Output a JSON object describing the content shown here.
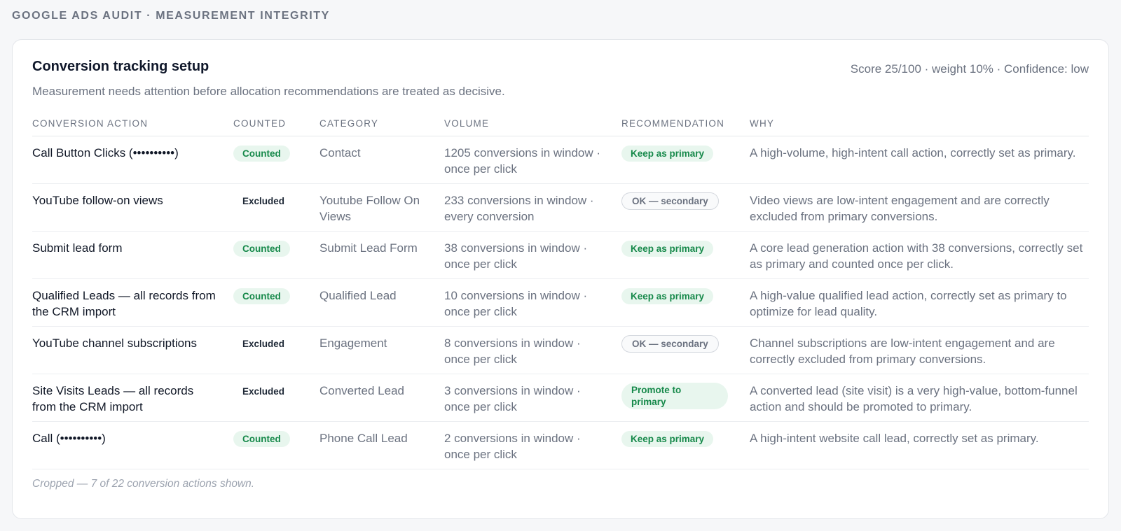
{
  "page": {
    "eyebrow": "GOOGLE ADS AUDIT · MEASUREMENT INTEGRITY"
  },
  "card": {
    "title": "Conversion tracking setup",
    "score_line": "Score 25/100 · weight 10% · Confidence: low",
    "subtitle": "Measurement needs attention before allocation recommendations are treated as decisive.",
    "footnote": "Cropped — 7 of 22 conversion actions shown."
  },
  "table": {
    "headers": [
      "CONVERSION ACTION",
      "COUNTED",
      "CATEGORY",
      "VOLUME",
      "RECOMMENDATION",
      "WHY"
    ],
    "rows": [
      {
        "action": "Call Button Clicks (••••••••••)",
        "counted": "Counted",
        "category": "Contact",
        "volume": "1205 conversions in window · once per click",
        "recommendation": "Keep as primary",
        "why": "A high-volume, high-intent call action, correctly set as primary."
      },
      {
        "action": "YouTube follow-on views",
        "counted": "Excluded",
        "category": "Youtube Follow On Views",
        "volume": "233 conversions in window · every conversion",
        "recommendation": "OK — secondary",
        "why": "Video views are low-intent engagement and are correctly excluded from primary conversions."
      },
      {
        "action": "Submit lead form",
        "counted": "Counted",
        "category": "Submit Lead Form",
        "volume": "38 conversions in window · once per click",
        "recommendation": "Keep as primary",
        "why": "A core lead generation action with 38 conversions, correctly set as primary and counted once per click."
      },
      {
        "action": "Qualified Leads — all records from the CRM import",
        "counted": "Counted",
        "category": "Qualified Lead",
        "volume": "10 conversions in window · once per click",
        "recommendation": "Keep as primary",
        "why": "A high-value qualified lead action, correctly set as primary to optimize for lead quality."
      },
      {
        "action": "YouTube channel subscriptions",
        "counted": "Excluded",
        "category": "Engagement",
        "volume": "8 conversions in window · once per click",
        "recommendation": "OK — secondary",
        "why": "Channel subscriptions are low-intent engagement and are correctly excluded from primary conversions."
      },
      {
        "action": "Site Visits Leads — all records from the CRM import",
        "counted": "Excluded",
        "category": "Converted Lead",
        "volume": "3 conversions in window · once per click",
        "recommendation": "Promote to primary",
        "why": "A converted lead (site visit) is a very high-value, bottom-funnel action and should be promoted to primary."
      },
      {
        "action": "Call (••••••••••)",
        "counted": "Counted",
        "category": "Phone Call Lead",
        "volume": "2 conversions in window · once per click",
        "recommendation": "Keep as primary",
        "why": "A high-intent website call lead, correctly set as primary."
      }
    ]
  },
  "colors": {
    "positive": "#16894a",
    "positive_bg": "#e8f6ee",
    "muted": "#6b7280"
  }
}
